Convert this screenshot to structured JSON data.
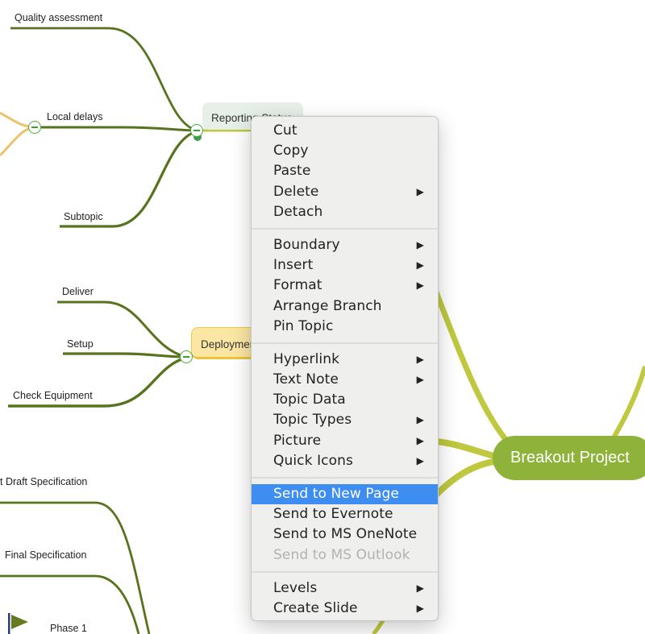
{
  "mindmap": {
    "central_topic": "Breakout Project",
    "topics": {
      "reporting": "Reporting Status",
      "deployment": "Deployment"
    },
    "subtopics": {
      "quality_assessment": "Quality assessment",
      "local_delays": "Local delays",
      "subtopic": "Subtopic",
      "deliver": "Deliver",
      "setup": "Setup",
      "check_equipment": "Check Equipment",
      "draft_specification": "t Draft Specification",
      "final_specification": "Final Specification",
      "phase_1": "Phase 1"
    },
    "icons": {
      "collapse": "collapse-minus-icon",
      "flag": "flag-icon"
    },
    "colors": {
      "central_fill": "#8fb33a",
      "main_branch": "#bfc83e",
      "sub_branch": "#57731d",
      "orange_branch": "#ecc36a",
      "deployment_fill": "#fbe6a3",
      "reporting_fill": "#e6efe8",
      "highlight": "#3d8ef0"
    }
  },
  "context_menu": {
    "groups": [
      [
        {
          "label": "Cut",
          "submenu": false
        },
        {
          "label": "Copy",
          "submenu": false
        },
        {
          "label": "Paste",
          "submenu": false
        },
        {
          "label": "Delete",
          "submenu": true
        },
        {
          "label": "Detach",
          "submenu": false
        }
      ],
      [
        {
          "label": "Boundary",
          "submenu": true
        },
        {
          "label": "Insert",
          "submenu": true
        },
        {
          "label": "Format",
          "submenu": true
        },
        {
          "label": "Arrange Branch",
          "submenu": false
        },
        {
          "label": "Pin Topic",
          "submenu": false
        }
      ],
      [
        {
          "label": "Hyperlink",
          "submenu": true
        },
        {
          "label": "Text Note",
          "submenu": true
        },
        {
          "label": "Topic Data",
          "submenu": false
        },
        {
          "label": "Topic Types",
          "submenu": true
        },
        {
          "label": "Picture",
          "submenu": true
        },
        {
          "label": "Quick Icons",
          "submenu": true
        }
      ],
      [
        {
          "label": "Send to New Page",
          "submenu": false,
          "highlighted": true
        },
        {
          "label": "Send to Evernote",
          "submenu": false
        },
        {
          "label": "Send to MS OneNote",
          "submenu": false
        },
        {
          "label": "Send to MS Outlook",
          "submenu": false,
          "disabled": true
        }
      ],
      [
        {
          "label": "Levels",
          "submenu": true
        },
        {
          "label": "Create Slide",
          "submenu": true
        }
      ]
    ],
    "submenu_arrow": "▶"
  }
}
